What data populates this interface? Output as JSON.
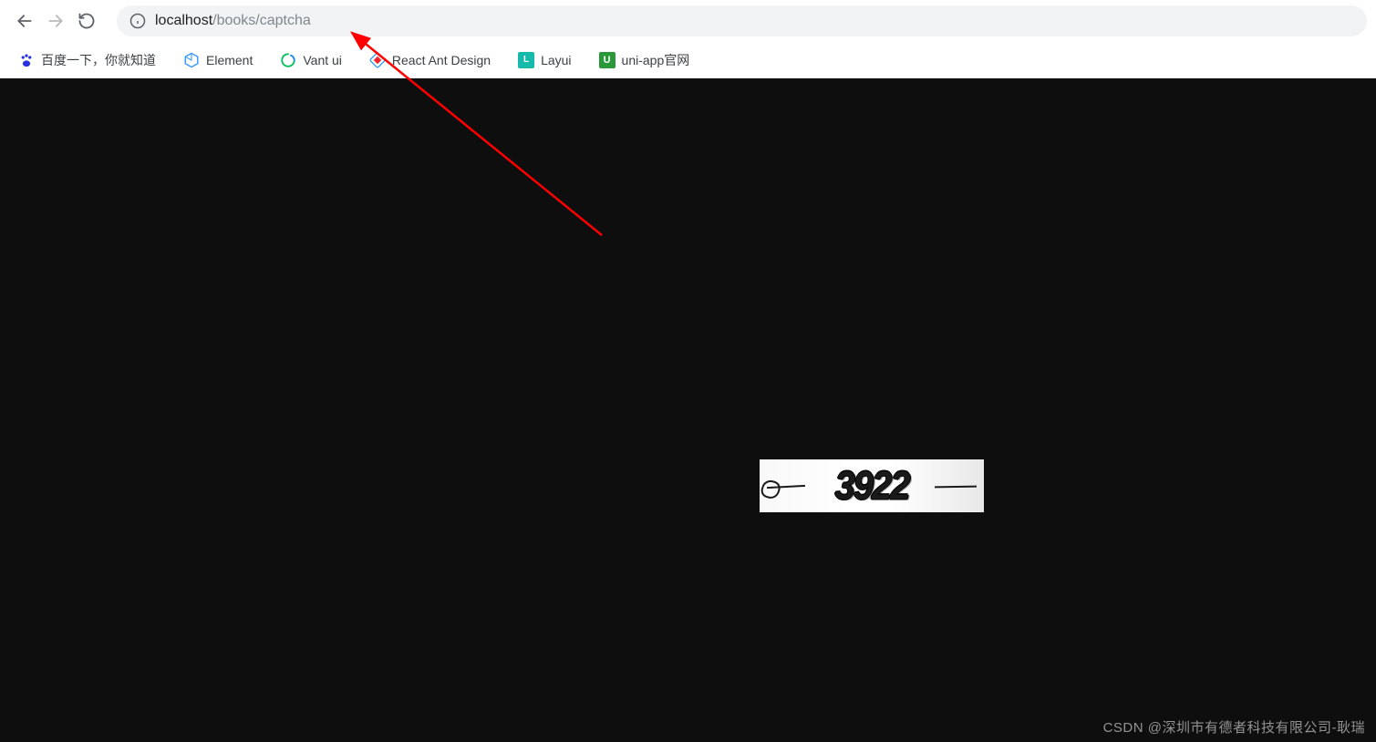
{
  "address": {
    "host": "localhost",
    "path": "/books/captcha"
  },
  "bookmarks": [
    {
      "label": "百度一下，你就知道",
      "icon": "baidu"
    },
    {
      "label": "Element",
      "icon": "element"
    },
    {
      "label": "Vant ui",
      "icon": "vant"
    },
    {
      "label": "React Ant Design",
      "icon": "react"
    },
    {
      "label": "Layui",
      "icon": "layui",
      "icon_text": "L"
    },
    {
      "label": "uni-app官网",
      "icon": "uniapp",
      "icon_text": "U"
    }
  ],
  "captcha": {
    "text": "3922"
  },
  "watermark": "CSDN @深圳市有德者科技有限公司-耿瑞"
}
